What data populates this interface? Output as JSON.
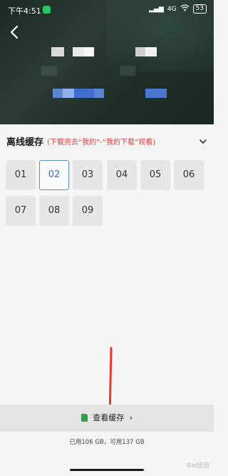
{
  "status_bar": {
    "time": "下午4:51",
    "signal": "4G",
    "wifi_icon": "wifi-icon",
    "battery": "53"
  },
  "header": {
    "back_icon": "back-arrow-icon"
  },
  "section": {
    "title": "离线缓存",
    "hint": "(下载完去“我的”-“我的下载”观看)",
    "collapse_icon": "chevron-down-icon"
  },
  "episodes": [
    {
      "label": "01",
      "selected": false
    },
    {
      "label": "02",
      "selected": true
    },
    {
      "label": "03",
      "selected": false
    },
    {
      "label": "04",
      "selected": false
    },
    {
      "label": "05",
      "selected": false
    },
    {
      "label": "06",
      "selected": false
    },
    {
      "label": "07",
      "selected": false
    },
    {
      "label": "08",
      "selected": false
    },
    {
      "label": "09",
      "selected": false
    }
  ],
  "bottom_bar": {
    "label": "查看缓存",
    "icon": "sd-card-icon",
    "arrow": "›"
  },
  "storage": {
    "text": "已用106 GB，可用137 GB"
  },
  "watermark": "Bai经验",
  "colors": {
    "hint_red": "#e23b3b",
    "selected_blue": "#5b8cc8",
    "annotation_red": "#e53a2e"
  }
}
